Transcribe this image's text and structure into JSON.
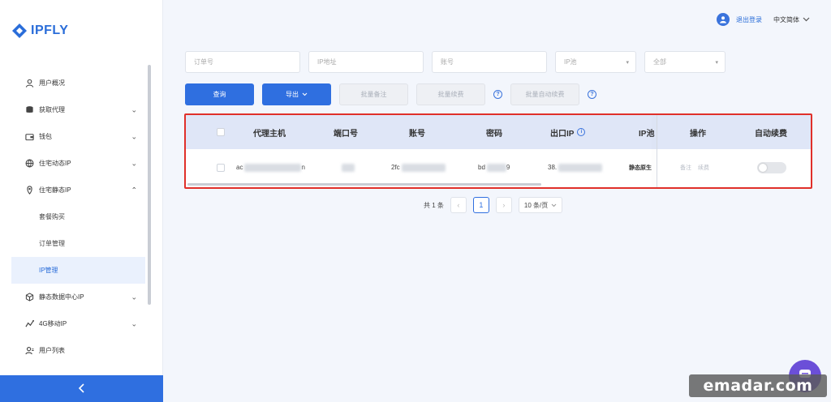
{
  "brand": {
    "name": "IPFLY",
    "accent": "#2f6fe0"
  },
  "header": {
    "logout": "退出登录",
    "language": "中文简体"
  },
  "sidebar": {
    "items": [
      {
        "label": "用户概况",
        "icon": "user-icon"
      },
      {
        "label": "获取代理",
        "icon": "database-icon",
        "expand": "chevron-down-icon"
      },
      {
        "label": "钱包",
        "icon": "wallet-icon",
        "expand": "chevron-down-icon"
      },
      {
        "label": "住宅动态IP",
        "icon": "globe-icon",
        "expand": "chevron-down-icon"
      },
      {
        "label": "住宅静态IP",
        "icon": "location-pin-icon",
        "expand": "chevron-up-icon"
      },
      {
        "label": "套餐购买",
        "sub": true
      },
      {
        "label": "订单管理",
        "sub": true
      },
      {
        "label": "IP管理",
        "sub": true,
        "active": true
      },
      {
        "label": "静态数据中心IP",
        "icon": "cube-icon",
        "expand": "chevron-down-icon"
      },
      {
        "label": "4G移动IP",
        "icon": "signal-icon",
        "expand": "chevron-down-icon"
      },
      {
        "label": "用户列表",
        "icon": "user-list-icon"
      }
    ],
    "collapse_icon": "chevron-left-icon"
  },
  "filters": {
    "order_no": "订单号",
    "ip_address": "IP地址",
    "account": "账号",
    "ip_pool": "IP池",
    "status": "全部"
  },
  "actions": {
    "query": "查询",
    "export": "导出",
    "batch_remark": "批量备注",
    "batch_renew": "批量续费",
    "batch_auto_renew": "批量自动续费"
  },
  "table": {
    "headers": {
      "host": "代理主机",
      "port": "端口号",
      "account": "账号",
      "password": "密码",
      "exit_ip": "出口IP",
      "ip_pool": "IP池",
      "operation": "操作",
      "auto_renew": "自动续费"
    },
    "rows": [
      {
        "host": "ac",
        "host_tail": "n",
        "account": "2fc",
        "password": "bd",
        "password_tail": "9",
        "exit_ip": "38.",
        "ip_pool": "静态原生",
        "op_remark": "备注",
        "op_renew": "续费",
        "auto_renew": false
      }
    ]
  },
  "pagination": {
    "total": "共 1 条",
    "current_page": "1",
    "page_size": "10 条/页"
  },
  "watermark": "emadar.com"
}
